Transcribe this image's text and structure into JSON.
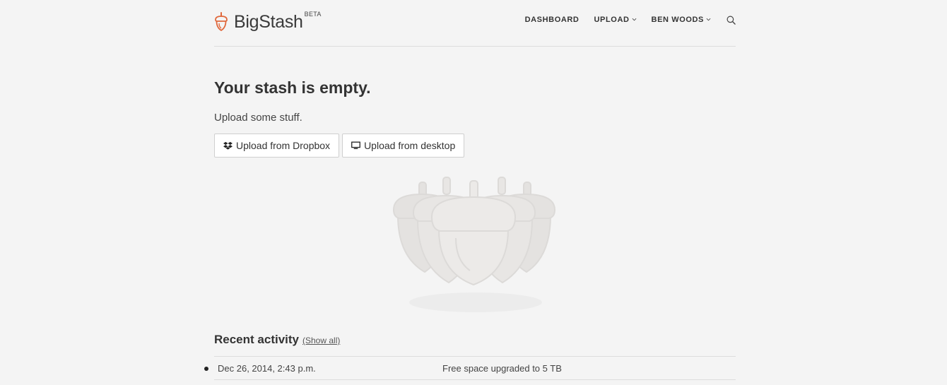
{
  "header": {
    "brand": "BigStash",
    "beta_label": "BETA",
    "nav": {
      "dashboard": "DASHBOARD",
      "upload": "UPLOAD",
      "user": "BEN WOODS"
    }
  },
  "main": {
    "title": "Your stash is empty.",
    "subtitle": "Upload some stuff.",
    "buttons": {
      "dropbox": "Upload from Dropbox",
      "desktop": "Upload from desktop"
    }
  },
  "recent_activity": {
    "title": "Recent activity",
    "show_all": "(Show all)",
    "items": [
      {
        "date": "Dec 26, 2014, 2:43 p.m.",
        "description": "Free space upgraded to 5 TB"
      }
    ]
  },
  "colors": {
    "brand": "#e0683c",
    "background": "#f4f4f4"
  }
}
